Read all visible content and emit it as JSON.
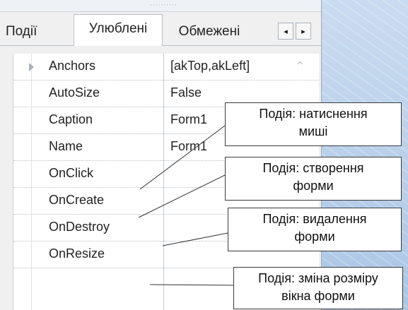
{
  "tabs": {
    "events": "Події",
    "favorites": "Улюблені",
    "restricted": "Обмежені",
    "nav_left": "◂",
    "nav_right": "▸"
  },
  "properties": [
    {
      "name": "Anchors",
      "value": "[akTop,akLeft]"
    },
    {
      "name": "AutoSize",
      "value": "False"
    },
    {
      "name": "Caption",
      "value": "Form1"
    },
    {
      "name": "Name",
      "value": "Form1"
    },
    {
      "name": "OnClick",
      "value": ""
    },
    {
      "name": "OnCreate",
      "value": ""
    },
    {
      "name": "OnDestroy",
      "value": ""
    },
    {
      "name": "OnResize",
      "value": ""
    }
  ],
  "callouts": [
    {
      "line1": "Подія: натиснення",
      "line2": "миші"
    },
    {
      "line1": "Подія: створення",
      "line2": "форми"
    },
    {
      "line1": "Подія: видалення",
      "line2": "форми"
    },
    {
      "line1": "Подія: зміна розміру",
      "line2": "вікна форми"
    }
  ],
  "icons": {
    "expand": "expand-arrow-icon",
    "dropdown": "dropdown-arrow-icon",
    "grip": "grip-dots-icon"
  },
  "colors": {
    "panel_bg": "#f0f0f0",
    "grid_bg": "#ffffff",
    "desktop_bg": "#c7d9ee"
  }
}
